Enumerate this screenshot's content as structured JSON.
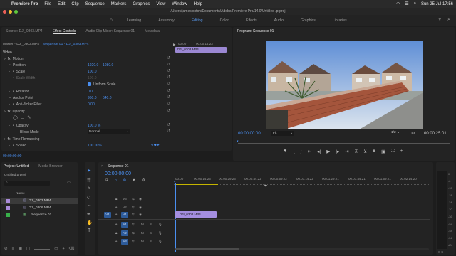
{
  "menubar": {
    "app": "Premiere Pro",
    "items": [
      "File",
      "Edit",
      "Clip",
      "Sequence",
      "Markers",
      "Graphics",
      "View",
      "Window",
      "Help"
    ],
    "clock": "Sun 25 Jul  17:56"
  },
  "titlebar": {
    "path": "/Users/jamesloxton/Documents/Adobe/Premiere Pro/14.0/Untitled .prproj"
  },
  "workspaces": {
    "items": [
      "Learning",
      "Assembly",
      "Editing",
      "Color",
      "Effects",
      "Audio",
      "Graphics",
      "Libraries"
    ],
    "active": "Editing"
  },
  "source_panel": {
    "tabs": [
      "Source: DJI_0303.MP4",
      "Effect Controls",
      "Audio Clip Mixer: Sequence 01",
      "Metadata"
    ],
    "header_master": "Master * DJI_0303.MP4",
    "header_seq": "Sequence 01 * DJI_0303.MP4",
    "mini_tc_left": "00:00",
    "mini_tc_right": "00:00:14:23",
    "mini_clip": "DJI_0303.MP4",
    "section_video": "Video",
    "rows": {
      "motion": "Motion",
      "position": "Position",
      "position_x": "1920.0",
      "position_y": "1080.0",
      "scale": "Scale",
      "scale_val": "100.0",
      "scale_width": "Scale Width",
      "scale_width_val": "100.0",
      "uniform": "Uniform Scale",
      "rotation": "Rotation",
      "rotation_val": "0.0",
      "anchor": "Anchor Point",
      "anchor_x": "960.0",
      "anchor_y": "540.0",
      "antiflicker": "Anti-flicker Filter",
      "antiflicker_val": "0.00",
      "opacity": "Opacity",
      "opacity_sub": "Opacity",
      "opacity_val": "100.0 %",
      "blend": "Blend Mode",
      "blend_val": "Normal",
      "time_remap": "Time Remapping",
      "speed": "Speed",
      "speed_val": "100.00%"
    },
    "footer_tc": "00:00:00:00"
  },
  "program": {
    "title": "Program: Sequence 01",
    "tc_current": "00:00:00:00",
    "fit": "Fit",
    "resolution": "1/2",
    "tc_duration": "00:00:25:01"
  },
  "project": {
    "tabs": [
      "Project: Untitled",
      "Media Browser"
    ],
    "file": "Untitled.prproj",
    "search_placeholder": "",
    "column": "Name",
    "items": [
      {
        "name": "DJI_0303.MP4",
        "color": "#a98ad9"
      },
      {
        "name": "DJI_0306.MP4",
        "color": "#a98ad9"
      },
      {
        "name": "Sequence 01",
        "color": "#38b04a"
      }
    ]
  },
  "timeline": {
    "tab": "Sequence 01",
    "tc": "00:00:00:00",
    "ruler": [
      "00:00",
      "00:00:14:23",
      "00:00:29:23",
      "00:00:44:22",
      "00:00:59:22",
      "00:01:14:22",
      "00:01:29:21",
      "00:01:44:21",
      "00:01:59:21",
      "00:02:14:20"
    ],
    "video_tracks": [
      "V3",
      "V2",
      "V1"
    ],
    "audio_tracks": [
      "A1",
      "A2",
      "A3"
    ],
    "source_patch_v": "V1",
    "clip": "DJI_0303.MP4"
  },
  "meter": {
    "labels": [
      "0",
      "-6",
      "-12",
      "-18",
      "-24",
      "-30",
      "-36",
      "-42",
      "-48",
      "-54",
      "dB"
    ]
  }
}
